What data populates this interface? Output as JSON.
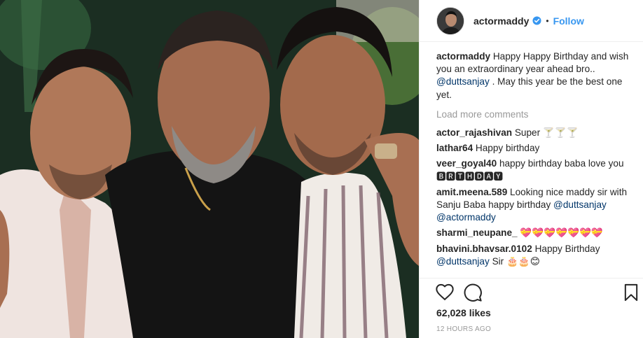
{
  "post": {
    "photo_alt": "Three men posing together at a party",
    "username": "actormaddy",
    "dot": "•",
    "follow_label": "Follow",
    "caption": {
      "user": "actormaddy",
      "text_before": "Happy Happy Birthday and wish you an extraordinary year ahead bro..",
      "mention": "@duttsanjay",
      "text_after": ". May this year be the best one yet."
    },
    "load_more_label": "Load more comments",
    "comments": [
      {
        "user": "actor_rajashivan",
        "text": "Super 🍸🍸🍸",
        "mention": "",
        "text2": ""
      },
      {
        "user": "lathar64",
        "text": "Happy birthday",
        "mention": "",
        "text2": ""
      },
      {
        "user": "veer_goyal40",
        "text": "happy birthday baba love you 🅱🆁🆃🅷🅳🅰🆈",
        "mention": "",
        "text2": ""
      },
      {
        "user": "amit.meena.589",
        "text": "Looking nice maddy sir with Sanju Baba happy birthday",
        "mention": "@duttsanjay @actormaddy",
        "text2": ""
      },
      {
        "user": "sharmi_neupane_",
        "text": "💝💝💝💝💝💝💝",
        "mention": "",
        "text2": ""
      },
      {
        "user": "bhavini.bhavsar.0102",
        "text": "Happy Birthday",
        "mention": "@duttsanjay",
        "text2": "Sir 🎂🎂😊"
      }
    ],
    "likes": "62,028 likes",
    "timestamp": "12 HOURS AGO",
    "icons": {
      "like": "heart-icon",
      "comment": "comment-bubble-icon",
      "save": "bookmark-icon",
      "verified": "verified-badge-icon"
    },
    "colors": {
      "follow": "#3897f0",
      "verified": "#3897f0",
      "mention": "#003569",
      "muted": "#999999"
    }
  }
}
